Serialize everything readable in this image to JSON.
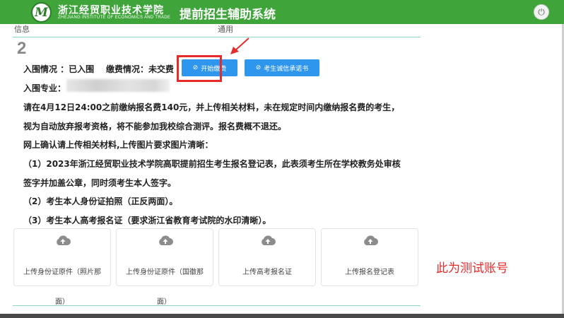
{
  "header": {
    "logo_letter": "M",
    "school_name": "浙江经贸职业技术学院",
    "school_name_en": "ZHEJIANG INSTITUTE OF ECONOMICS AND TRADE",
    "system_title": "提前招生辅助系统",
    "power_icon": "power-icon"
  },
  "cut_row": {
    "left": "信息",
    "right": "通用"
  },
  "step_number": "2",
  "status": {
    "admission_label": "入围情况 ：已入围",
    "payment_label": "缴费情况：未交费"
  },
  "buttons": {
    "start_payment": "开始缴费",
    "integrity_pledge": "考生诚信承诺书"
  },
  "major_label": "入围专业：",
  "instructions": [
    "请在4月12日24:00之前缴纳报名费140元，并上传相关材料，未在规定时间内缴纳报名费的考生，",
    "视为自动放弃报考资格，将不能参加我校综合测评。报名费概不退还。",
    "网上确认请上传相关材料,上传图片要求图片清晰：",
    "（1）2023年浙江经贸职业技术学院高职提前招生考生报名登记表，此表须考生所在学校教务处审核",
    "签字并加盖公章，同时须考生本人签字。",
    "（2）考生本人身份证拍照（正反两面）。",
    "（3）考生本人高考报名证（要求浙江省教育考试院的水印清晰）。"
  ],
  "uploads": [
    {
      "label": "上传身份证原件（照片那",
      "tail": "面）"
    },
    {
      "label": "上传身份证原件（国徽那",
      "tail": "面）"
    },
    {
      "label": "上传高考报名证"
    },
    {
      "label": "上传报名登记表"
    }
  ],
  "note": "此为测试账号",
  "colors": {
    "header": "#3fa53a",
    "button": "#2f96ee",
    "highlight": "#e52b2b"
  }
}
